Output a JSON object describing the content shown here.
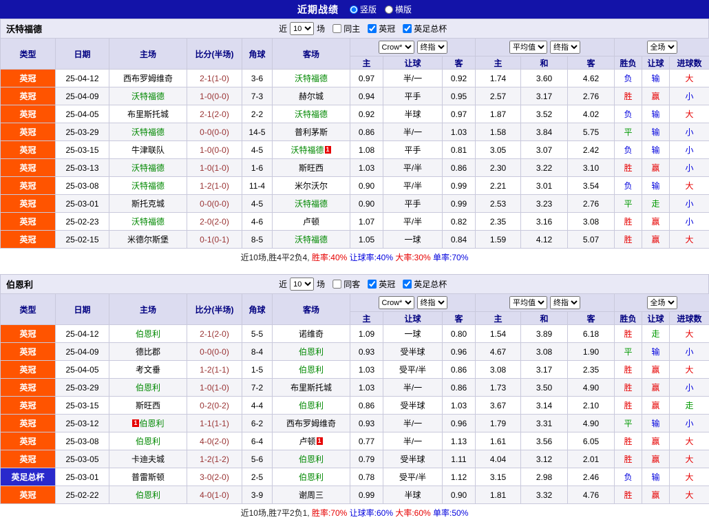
{
  "topbar": {
    "title": "近期战绩",
    "radios": [
      {
        "label": "竖版",
        "selected": true
      },
      {
        "label": "横版",
        "selected": false
      }
    ]
  },
  "colors": {
    "topbar_navy": "#1313a8",
    "win_red": "#e60000",
    "lose_blue": "#0000dd",
    "draw_green": "#009900",
    "highlight_team_green": "#008800",
    "score_maroon": "#993333",
    "league_badge_orange": "#ff5400",
    "cup_badge_blue": "#2929cc",
    "header_lavender": "#dcdcf0"
  },
  "table_header": {
    "left_cols": [
      "类型",
      "日期",
      "主场",
      "比分(半场)",
      "角球",
      "客场"
    ],
    "groups": [
      {
        "name": "asian-handicap",
        "selects": [
          {
            "name": "bookmaker-select",
            "value": "Crow*"
          },
          {
            "name": "ah-stage-select",
            "value": "终指"
          }
        ],
        "cols": [
          "主",
          "让球",
          "客"
        ]
      },
      {
        "name": "european-odds",
        "selects": [
          {
            "name": "eu-average-select",
            "value": "平均值"
          },
          {
            "name": "eu-stage-select",
            "value": "终指"
          }
        ],
        "cols": [
          "主",
          "和",
          "客"
        ]
      },
      {
        "name": "fulltime-result",
        "selects": [
          {
            "name": "fulltime-select",
            "value": "全场"
          }
        ],
        "cols": [
          "胜负",
          "让球",
          "进球数"
        ]
      }
    ]
  },
  "sections": [
    {
      "team": "沃特福德",
      "filter": {
        "recent_prefix": "近",
        "recent_count": "10",
        "recent_suffix": "场",
        "checkboxes": [
          {
            "label": "同主",
            "checked": false
          },
          {
            "label": "英冠",
            "checked": true
          },
          {
            "label": "英足总杯",
            "checked": true
          }
        ]
      },
      "rows": [
        {
          "type": "英冠",
          "cup": false,
          "date": "25-04-12",
          "home": {
            "name": "西布罗姆维奇"
          },
          "score": "2-1(1-0)",
          "corners": "3-6",
          "away": {
            "name": "沃特福德",
            "hl": true
          },
          "ah": [
            "0.97",
            "半/一",
            "0.92"
          ],
          "eu": [
            "1.74",
            "3.60",
            "4.62"
          ],
          "results": [
            {
              "t": "负",
              "c": "blue"
            },
            {
              "t": "输",
              "c": "blue"
            },
            {
              "t": "大",
              "c": "red"
            }
          ]
        },
        {
          "type": "英冠",
          "cup": false,
          "date": "25-04-09",
          "home": {
            "name": "沃特福德",
            "hl": true
          },
          "score": "1-0(0-0)",
          "corners": "7-3",
          "away": {
            "name": "赫尔城"
          },
          "ah": [
            "0.94",
            "平手",
            "0.95"
          ],
          "eu": [
            "2.57",
            "3.17",
            "2.76"
          ],
          "results": [
            {
              "t": "胜",
              "c": "red"
            },
            {
              "t": "赢",
              "c": "red"
            },
            {
              "t": "小",
              "c": "blue"
            }
          ]
        },
        {
          "type": "英冠",
          "cup": false,
          "date": "25-04-05",
          "home": {
            "name": "布里斯托城"
          },
          "score": "2-1(2-0)",
          "corners": "2-2",
          "away": {
            "name": "沃特福德",
            "hl": true
          },
          "ah": [
            "0.92",
            "半球",
            "0.97"
          ],
          "eu": [
            "1.87",
            "3.52",
            "4.02"
          ],
          "results": [
            {
              "t": "负",
              "c": "blue"
            },
            {
              "t": "输",
              "c": "blue"
            },
            {
              "t": "大",
              "c": "red"
            }
          ]
        },
        {
          "type": "英冠",
          "cup": false,
          "date": "25-03-29",
          "home": {
            "name": "沃特福德",
            "hl": true
          },
          "score": "0-0(0-0)",
          "corners": "14-5",
          "away": {
            "name": "普利茅斯"
          },
          "ah": [
            "0.86",
            "半/一",
            "1.03"
          ],
          "eu": [
            "1.58",
            "3.84",
            "5.75"
          ],
          "results": [
            {
              "t": "平",
              "c": "green"
            },
            {
              "t": "输",
              "c": "blue"
            },
            {
              "t": "小",
              "c": "blue"
            }
          ]
        },
        {
          "type": "英冠",
          "cup": false,
          "date": "25-03-15",
          "home": {
            "name": "牛津联队"
          },
          "score": "1-0(0-0)",
          "corners": "4-5",
          "away": {
            "name": "沃特福德",
            "hl": true,
            "badge": "1",
            "badge_side": "after"
          },
          "ah": [
            "1.08",
            "平手",
            "0.81"
          ],
          "eu": [
            "3.05",
            "3.07",
            "2.42"
          ],
          "results": [
            {
              "t": "负",
              "c": "blue"
            },
            {
              "t": "输",
              "c": "blue"
            },
            {
              "t": "小",
              "c": "blue"
            }
          ]
        },
        {
          "type": "英冠",
          "cup": false,
          "date": "25-03-13",
          "home": {
            "name": "沃特福德",
            "hl": true
          },
          "score": "1-0(1-0)",
          "corners": "1-6",
          "away": {
            "name": "斯旺西"
          },
          "ah": [
            "1.03",
            "平/半",
            "0.86"
          ],
          "eu": [
            "2.30",
            "3.22",
            "3.10"
          ],
          "results": [
            {
              "t": "胜",
              "c": "red"
            },
            {
              "t": "赢",
              "c": "red"
            },
            {
              "t": "小",
              "c": "blue"
            }
          ]
        },
        {
          "type": "英冠",
          "cup": false,
          "date": "25-03-08",
          "home": {
            "name": "沃特福德",
            "hl": true
          },
          "score": "1-2(1-0)",
          "corners": "11-4",
          "away": {
            "name": "米尔沃尔"
          },
          "ah": [
            "0.90",
            "平/半",
            "0.99"
          ],
          "eu": [
            "2.21",
            "3.01",
            "3.54"
          ],
          "results": [
            {
              "t": "负",
              "c": "blue"
            },
            {
              "t": "输",
              "c": "blue"
            },
            {
              "t": "大",
              "c": "red"
            }
          ]
        },
        {
          "type": "英冠",
          "cup": false,
          "date": "25-03-01",
          "home": {
            "name": "斯托克城"
          },
          "score": "0-0(0-0)",
          "corners": "4-5",
          "away": {
            "name": "沃特福德",
            "hl": true
          },
          "ah": [
            "0.90",
            "平手",
            "0.99"
          ],
          "eu": [
            "2.53",
            "3.23",
            "2.76"
          ],
          "results": [
            {
              "t": "平",
              "c": "green"
            },
            {
              "t": "走",
              "c": "green"
            },
            {
              "t": "小",
              "c": "blue"
            }
          ]
        },
        {
          "type": "英冠",
          "cup": false,
          "date": "25-02-23",
          "home": {
            "name": "沃特福德",
            "hl": true
          },
          "score": "2-0(2-0)",
          "corners": "4-6",
          "away": {
            "name": "卢顿"
          },
          "ah": [
            "1.07",
            "平/半",
            "0.82"
          ],
          "eu": [
            "2.35",
            "3.16",
            "3.08"
          ],
          "results": [
            {
              "t": "胜",
              "c": "red"
            },
            {
              "t": "赢",
              "c": "red"
            },
            {
              "t": "小",
              "c": "blue"
            }
          ]
        },
        {
          "type": "英冠",
          "cup": false,
          "date": "25-02-15",
          "home": {
            "name": "米德尔斯堡"
          },
          "score": "0-1(0-1)",
          "corners": "8-5",
          "away": {
            "name": "沃特福德",
            "hl": true
          },
          "ah": [
            "1.05",
            "一球",
            "0.84"
          ],
          "eu": [
            "1.59",
            "4.12",
            "5.07"
          ],
          "results": [
            {
              "t": "胜",
              "c": "red"
            },
            {
              "t": "赢",
              "c": "red"
            },
            {
              "t": "大",
              "c": "red"
            }
          ]
        }
      ],
      "summary": [
        {
          "text": "近10场,胜4平2负4,",
          "cls": "s-dark"
        },
        {
          "text": " 胜率:40%",
          "cls": "s-red"
        },
        {
          "text": " 让球率:40%",
          "cls": "s-blue"
        },
        {
          "text": " 大率:30%",
          "cls": "s-red"
        },
        {
          "text": " 单率:70%",
          "cls": "s-blue"
        }
      ]
    },
    {
      "team": "伯恩利",
      "filter": {
        "recent_prefix": "近",
        "recent_count": "10",
        "recent_suffix": "场",
        "checkboxes": [
          {
            "label": "同客",
            "checked": false
          },
          {
            "label": "英冠",
            "checked": true
          },
          {
            "label": "英足总杯",
            "checked": true
          }
        ]
      },
      "rows": [
        {
          "type": "英冠",
          "cup": false,
          "date": "25-04-12",
          "home": {
            "name": "伯恩利",
            "hl": true
          },
          "score": "2-1(2-0)",
          "corners": "5-5",
          "away": {
            "name": "诺维奇"
          },
          "ah": [
            "1.09",
            "一球",
            "0.80"
          ],
          "eu": [
            "1.54",
            "3.89",
            "6.18"
          ],
          "results": [
            {
              "t": "胜",
              "c": "red"
            },
            {
              "t": "走",
              "c": "green"
            },
            {
              "t": "大",
              "c": "red"
            }
          ]
        },
        {
          "type": "英冠",
          "cup": false,
          "date": "25-04-09",
          "home": {
            "name": "德比郡"
          },
          "score": "0-0(0-0)",
          "corners": "8-4",
          "away": {
            "name": "伯恩利",
            "hl": true
          },
          "ah": [
            "0.93",
            "受半球",
            "0.96"
          ],
          "eu": [
            "4.67",
            "3.08",
            "1.90"
          ],
          "results": [
            {
              "t": "平",
              "c": "green"
            },
            {
              "t": "输",
              "c": "blue"
            },
            {
              "t": "小",
              "c": "blue"
            }
          ]
        },
        {
          "type": "英冠",
          "cup": false,
          "date": "25-04-05",
          "home": {
            "name": "考文垂"
          },
          "score": "1-2(1-1)",
          "corners": "1-5",
          "away": {
            "name": "伯恩利",
            "hl": true
          },
          "ah": [
            "1.03",
            "受平/半",
            "0.86"
          ],
          "eu": [
            "3.08",
            "3.17",
            "2.35"
          ],
          "results": [
            {
              "t": "胜",
              "c": "red"
            },
            {
              "t": "赢",
              "c": "red"
            },
            {
              "t": "大",
              "c": "red"
            }
          ]
        },
        {
          "type": "英冠",
          "cup": false,
          "date": "25-03-29",
          "home": {
            "name": "伯恩利",
            "hl": true
          },
          "score": "1-0(1-0)",
          "corners": "7-2",
          "away": {
            "name": "布里斯托城"
          },
          "ah": [
            "1.03",
            "半/一",
            "0.86"
          ],
          "eu": [
            "1.73",
            "3.50",
            "4.90"
          ],
          "results": [
            {
              "t": "胜",
              "c": "red"
            },
            {
              "t": "赢",
              "c": "red"
            },
            {
              "t": "小",
              "c": "blue"
            }
          ]
        },
        {
          "type": "英冠",
          "cup": false,
          "date": "25-03-15",
          "home": {
            "name": "斯旺西"
          },
          "score": "0-2(0-2)",
          "corners": "4-4",
          "away": {
            "name": "伯恩利",
            "hl": true
          },
          "ah": [
            "0.86",
            "受半球",
            "1.03"
          ],
          "eu": [
            "3.67",
            "3.14",
            "2.10"
          ],
          "results": [
            {
              "t": "胜",
              "c": "red"
            },
            {
              "t": "赢",
              "c": "red"
            },
            {
              "t": "走",
              "c": "green"
            }
          ]
        },
        {
          "type": "英冠",
          "cup": false,
          "date": "25-03-12",
          "home": {
            "name": "伯恩利",
            "hl": true,
            "badge": "1",
            "badge_side": "before"
          },
          "score": "1-1(1-1)",
          "corners": "6-2",
          "away": {
            "name": "西布罗姆维奇"
          },
          "ah": [
            "0.93",
            "半/一",
            "0.96"
          ],
          "eu": [
            "1.79",
            "3.31",
            "4.90"
          ],
          "results": [
            {
              "t": "平",
              "c": "green"
            },
            {
              "t": "输",
              "c": "blue"
            },
            {
              "t": "小",
              "c": "blue"
            }
          ]
        },
        {
          "type": "英冠",
          "cup": false,
          "date": "25-03-08",
          "home": {
            "name": "伯恩利",
            "hl": true
          },
          "score": "4-0(2-0)",
          "corners": "6-4",
          "away": {
            "name": "卢顿",
            "badge": "1",
            "badge_side": "after"
          },
          "ah": [
            "0.77",
            "半/一",
            "1.13"
          ],
          "eu": [
            "1.61",
            "3.56",
            "6.05"
          ],
          "results": [
            {
              "t": "胜",
              "c": "red"
            },
            {
              "t": "赢",
              "c": "red"
            },
            {
              "t": "大",
              "c": "red"
            }
          ]
        },
        {
          "type": "英冠",
          "cup": false,
          "date": "25-03-05",
          "home": {
            "name": "卡迪夫城"
          },
          "score": "1-2(1-2)",
          "corners": "5-6",
          "away": {
            "name": "伯恩利",
            "hl": true
          },
          "ah": [
            "0.79",
            "受半球",
            "1.11"
          ],
          "eu": [
            "4.04",
            "3.12",
            "2.01"
          ],
          "results": [
            {
              "t": "胜",
              "c": "red"
            },
            {
              "t": "赢",
              "c": "red"
            },
            {
              "t": "大",
              "c": "red"
            }
          ]
        },
        {
          "type": "英足总杯",
          "cup": true,
          "date": "25-03-01",
          "home": {
            "name": "普雷斯顿"
          },
          "score": "3-0(2-0)",
          "corners": "2-5",
          "away": {
            "name": "伯恩利",
            "hl": true
          },
          "ah": [
            "0.78",
            "受平/半",
            "1.12"
          ],
          "eu": [
            "3.15",
            "2.98",
            "2.46"
          ],
          "results": [
            {
              "t": "负",
              "c": "blue"
            },
            {
              "t": "输",
              "c": "blue"
            },
            {
              "t": "大",
              "c": "red"
            }
          ]
        },
        {
          "type": "英冠",
          "cup": false,
          "date": "25-02-22",
          "home": {
            "name": "伯恩利",
            "hl": true
          },
          "score": "4-0(1-0)",
          "corners": "3-9",
          "away": {
            "name": "谢周三"
          },
          "ah": [
            "0.99",
            "半球",
            "0.90"
          ],
          "eu": [
            "1.81",
            "3.32",
            "4.76"
          ],
          "results": [
            {
              "t": "胜",
              "c": "red"
            },
            {
              "t": "赢",
              "c": "red"
            },
            {
              "t": "大",
              "c": "red"
            }
          ]
        }
      ],
      "summary": [
        {
          "text": "近10场,胜7平2负1,",
          "cls": "s-dark"
        },
        {
          "text": " 胜率:70%",
          "cls": "s-red"
        },
        {
          "text": " 让球率:60%",
          "cls": "s-blue"
        },
        {
          "text": " 大率:60%",
          "cls": "s-red"
        },
        {
          "text": " 单率:50%",
          "cls": "s-blue"
        }
      ]
    }
  ]
}
